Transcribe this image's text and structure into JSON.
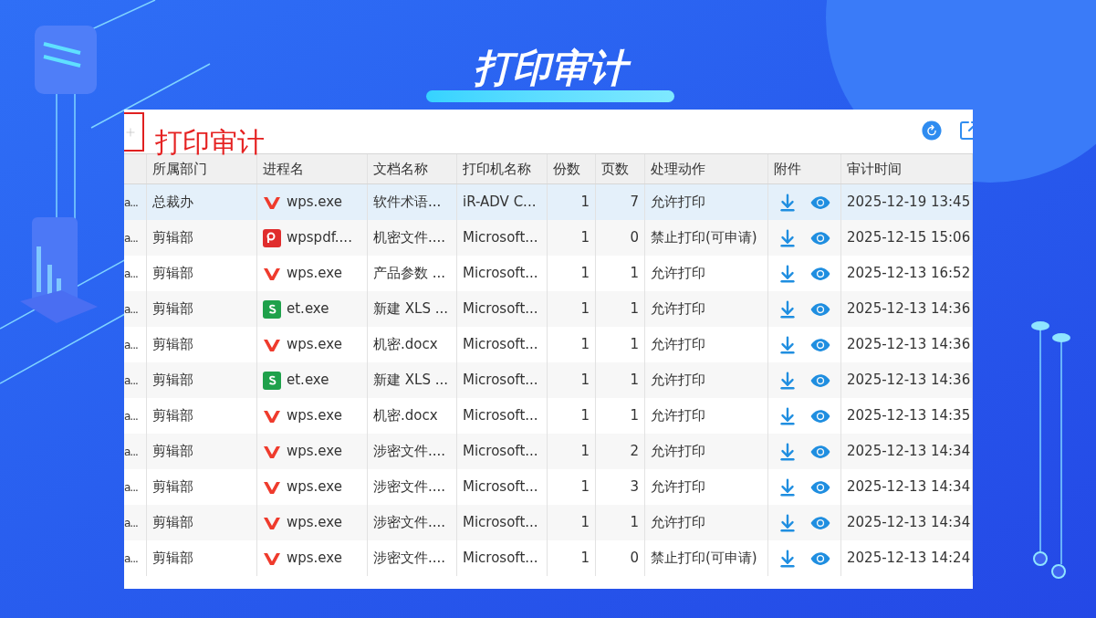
{
  "title": "打印审计",
  "toolbar": {
    "annotation": "打印审计"
  },
  "table": {
    "columns": [
      "所属部门",
      "进程名",
      "文档名称",
      "打印机名称",
      "份数",
      "页数",
      "处理动作",
      "附件",
      "审计时间"
    ],
    "rows": [
      {
        "column_1": "a...",
        "dept": "总裁办",
        "process": {
          "kind": "wps",
          "name": "wps.exe"
        },
        "document": "软件术语...",
        "printer": "iR-ADV C...",
        "copies": "1",
        "pages": "7",
        "action": "允许打印",
        "audit_time": "2025-12-19 13:45",
        "selected": true
      },
      {
        "column_1": "a...",
        "dept": "剪辑部",
        "process": {
          "kind": "pdf",
          "name": "wpspdf...."
        },
        "document": "机密文件....",
        "printer": "Microsoft...",
        "copies": "1",
        "pages": "0",
        "action": "禁止打印(可申请)",
        "audit_time": "2025-12-15 15:06",
        "selected": false
      },
      {
        "column_1": "a...",
        "dept": "剪辑部",
        "process": {
          "kind": "wps",
          "name": "wps.exe"
        },
        "document": "产品参数 ...",
        "printer": "Microsoft...",
        "copies": "1",
        "pages": "1",
        "action": "允许打印",
        "audit_time": "2025-12-13 16:52",
        "selected": false
      },
      {
        "column_1": "a...",
        "dept": "剪辑部",
        "process": {
          "kind": "et",
          "name": "et.exe"
        },
        "document": "新建 XLS ...",
        "printer": "Microsoft...",
        "copies": "1",
        "pages": "1",
        "action": "允许打印",
        "audit_time": "2025-12-13 14:36",
        "selected": false
      },
      {
        "column_1": "a...",
        "dept": "剪辑部",
        "process": {
          "kind": "wps",
          "name": "wps.exe"
        },
        "document": "机密.docx",
        "printer": "Microsoft...",
        "copies": "1",
        "pages": "1",
        "action": "允许打印",
        "audit_time": "2025-12-13 14:36",
        "selected": false
      },
      {
        "column_1": "a...",
        "dept": "剪辑部",
        "process": {
          "kind": "et",
          "name": "et.exe"
        },
        "document": "新建 XLS ...",
        "printer": "Microsoft...",
        "copies": "1",
        "pages": "1",
        "action": "允许打印",
        "audit_time": "2025-12-13 14:36",
        "selected": false
      },
      {
        "column_1": "a...",
        "dept": "剪辑部",
        "process": {
          "kind": "wps",
          "name": "wps.exe"
        },
        "document": "机密.docx",
        "printer": "Microsoft...",
        "copies": "1",
        "pages": "1",
        "action": "允许打印",
        "audit_time": "2025-12-13 14:35",
        "selected": false
      },
      {
        "column_1": "a...",
        "dept": "剪辑部",
        "process": {
          "kind": "wps",
          "name": "wps.exe"
        },
        "document": "涉密文件....",
        "printer": "Microsoft...",
        "copies": "1",
        "pages": "2",
        "action": "允许打印",
        "audit_time": "2025-12-13 14:34",
        "selected": false
      },
      {
        "column_1": "a...",
        "dept": "剪辑部",
        "process": {
          "kind": "wps",
          "name": "wps.exe"
        },
        "document": "涉密文件....",
        "printer": "Microsoft...",
        "copies": "1",
        "pages": "3",
        "action": "允许打印",
        "audit_time": "2025-12-13 14:34",
        "selected": false
      },
      {
        "column_1": "a...",
        "dept": "剪辑部",
        "process": {
          "kind": "wps",
          "name": "wps.exe"
        },
        "document": "涉密文件....",
        "printer": "Microsoft...",
        "copies": "1",
        "pages": "1",
        "action": "允许打印",
        "audit_time": "2025-12-13 14:34",
        "selected": false
      },
      {
        "column_1": "a...",
        "dept": "剪辑部",
        "process": {
          "kind": "wps",
          "name": "wps.exe"
        },
        "document": "涉密文件....",
        "printer": "Microsoft...",
        "copies": "1",
        "pages": "0",
        "action": "禁止打印(可申请)",
        "audit_time": "2025-12-13 14:24",
        "selected": false
      }
    ]
  }
}
